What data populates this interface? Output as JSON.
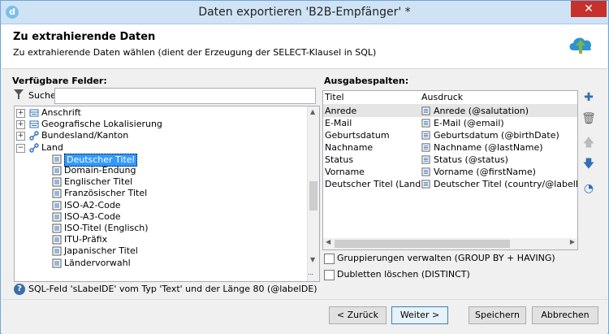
{
  "window": {
    "title": "Daten exportieren 'B2B-Empfänger' *",
    "close": "✕"
  },
  "header": {
    "title": "Zu extrahierende Daten",
    "subtitle": "Zu extrahierende Daten wählen (dient der Erzeugung der SELECT-Klausel in SQL)"
  },
  "left": {
    "label": "Verfügbare Felder:",
    "search_label": "Suchen:",
    "search_value": "",
    "tree": [
      {
        "label": "Anschrift",
        "expander": "+",
        "icon": "link-table-icon"
      },
      {
        "label": "Geografische Lokalisierung",
        "expander": "+",
        "icon": "link-table-icon"
      },
      {
        "label": "Bundesland/Kanton",
        "expander": "+",
        "icon": "link-icon"
      },
      {
        "label": "Land",
        "expander": "−",
        "icon": "link-icon"
      },
      {
        "label": "Deutscher Titel",
        "icon": "field-icon",
        "selected": true
      },
      {
        "label": "Domain-Endung",
        "icon": "field-icon"
      },
      {
        "label": "Englischer Titel",
        "icon": "field-icon"
      },
      {
        "label": "Französischer Titel",
        "icon": "field-icon"
      },
      {
        "label": "ISO-A2-Code",
        "icon": "field-icon"
      },
      {
        "label": "ISO-A3-Code",
        "icon": "field-icon"
      },
      {
        "label": "ISO-Titel (Englisch)",
        "icon": "field-icon"
      },
      {
        "label": "ITU-Präfix",
        "icon": "field-icon"
      },
      {
        "label": "Japanischer Titel",
        "icon": "field-icon"
      },
      {
        "label": "Ländervorwahl",
        "icon": "field-icon"
      }
    ]
  },
  "right": {
    "label": "Ausgabespalten:",
    "columns": [
      "Titel",
      "Ausdruck"
    ],
    "rows": [
      [
        "Anrede",
        "Anrede (@salutation)"
      ],
      [
        "E-Mail",
        "E-Mail (@email)"
      ],
      [
        "Geburtsdatum",
        "Geburtsdatum (@birthDate)"
      ],
      [
        "Nachname",
        "Nachname (@lastName)"
      ],
      [
        "Status",
        "Status (@status)"
      ],
      [
        "Vorname",
        "Vorname (@firstName)"
      ],
      [
        "Deutscher Titel (Land)",
        "Deutscher Titel (country/@labelDE)"
      ]
    ],
    "grouping_label": "Gruppierungen verwalten (GROUP BY + HAVING)",
    "distinct_label": "Dubletten löschen (DISTINCT)"
  },
  "status_text": "SQL-Feld 'sLabelDE' vom Typ 'Text' und der Länge 80 (@labelDE)",
  "buttons": {
    "back": "< Zurück",
    "next": "Weiter >",
    "save": "Speichern",
    "cancel": "Abbrechen"
  },
  "colors": {
    "accent": "#3399ff",
    "titlebar": "#cfe3f5",
    "close": "#c7312b"
  }
}
